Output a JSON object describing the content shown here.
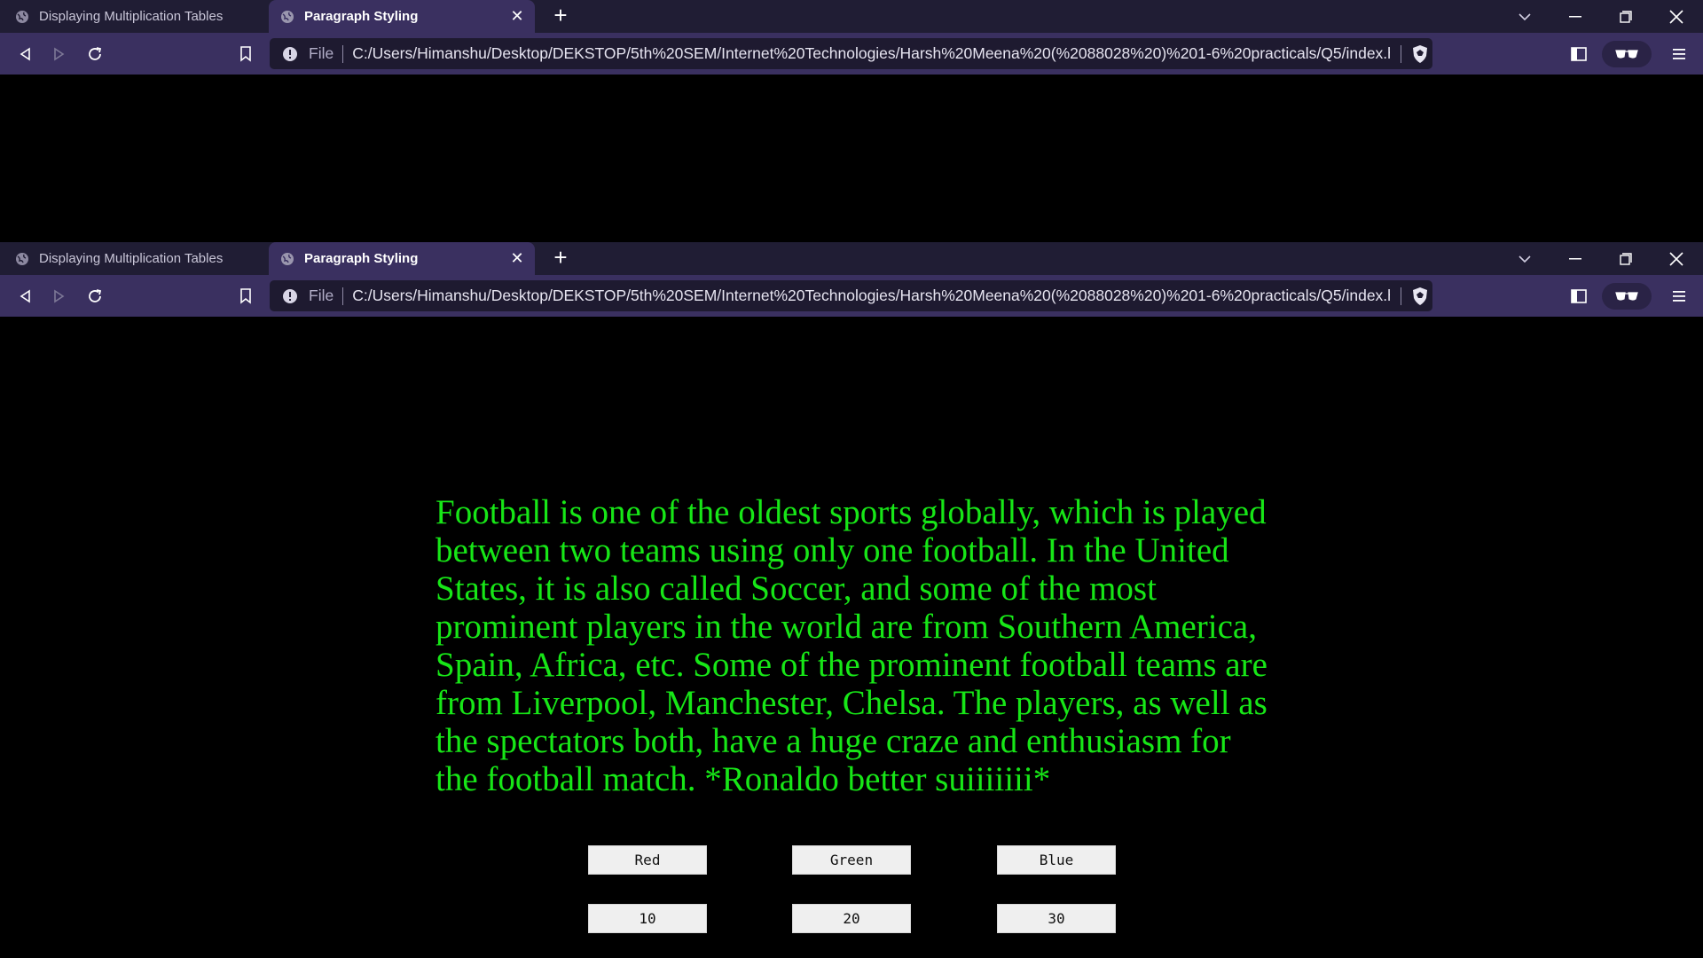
{
  "tabs": [
    {
      "title": "Displaying Multiplication Tables",
      "active": false
    },
    {
      "title": "Paragraph Styling",
      "active": true
    }
  ],
  "address_bar": {
    "scheme_label": "File",
    "url": "C:/Users/Himanshu/Desktop/DEKSTOP/5th%20SEM/Internet%20Technologies/Harsh%20Meena%20(%2088028%20)%201-6%20practicals/Q5/index.h..."
  },
  "page": {
    "paragraph": "Football is one of the oldest sports globally, which is played between two teams using only one football. In the United States, it is also called Soccer, and some of the most prominent players in the world are from Southern America, Spain, Africa, etc. Some of the prominent football teams are from Liverpool, Manchester, Chelsa. The players, as well as the spectators both, have a huge craze and enthusiasm for the football match. *Ronaldo better suiiiiiii*",
    "paragraph_color": "#17e617",
    "color_buttons": [
      "Red",
      "Green",
      "Blue"
    ],
    "size_buttons": [
      "10",
      "20",
      "30"
    ]
  },
  "theme": {
    "tabstrip_bg": "#201d34",
    "toolbar_bg": "#3a3060",
    "page_bg": "#000000"
  },
  "icons": [
    "globe-icon",
    "close-icon",
    "plus-icon",
    "chevron-down-icon",
    "minimize-icon",
    "restore-icon",
    "window-close-icon",
    "back-icon",
    "forward-icon",
    "reload-icon",
    "bookmark-icon",
    "info-icon",
    "brave-shield-icon",
    "sidebar-icon",
    "wallet-icon",
    "menu-icon"
  ]
}
